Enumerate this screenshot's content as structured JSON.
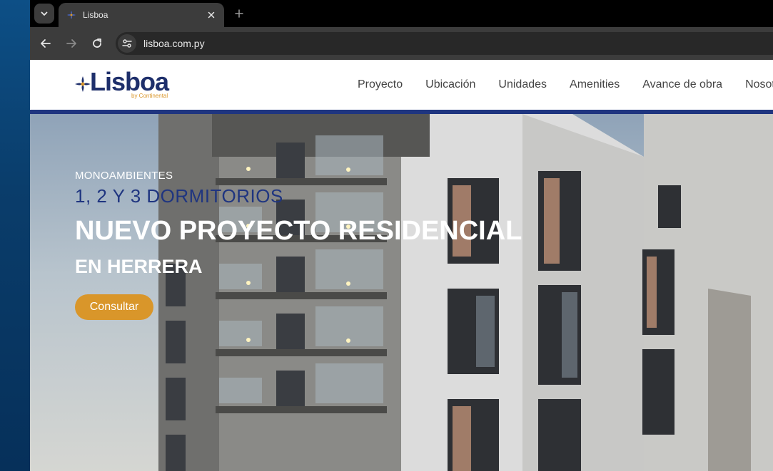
{
  "browser": {
    "tab": {
      "title": "Lisboa"
    },
    "address_bar": {
      "url": "lisboa.com.py"
    }
  },
  "site": {
    "logo": {
      "text": "Lisboa",
      "subtext": "by Continental"
    },
    "nav": [
      {
        "label": "Proyecto"
      },
      {
        "label": "Ubicación"
      },
      {
        "label": "Unidades"
      },
      {
        "label": "Amenities"
      },
      {
        "label": "Avance de obra"
      },
      {
        "label": "Nosotros"
      }
    ],
    "hero": {
      "kicker": "MONOAMBIENTES",
      "subtitle": "1, 2 Y 3 DORMITORIOS",
      "headline": "NUEVO PROYECTO RESIDENCIAL",
      "location": "EN HERRERA",
      "cta_label": "Consultar"
    }
  },
  "colors": {
    "brand_navy": "#1f3580",
    "brand_gold": "#d9962a",
    "browser_chrome": "#3c3c3c"
  }
}
